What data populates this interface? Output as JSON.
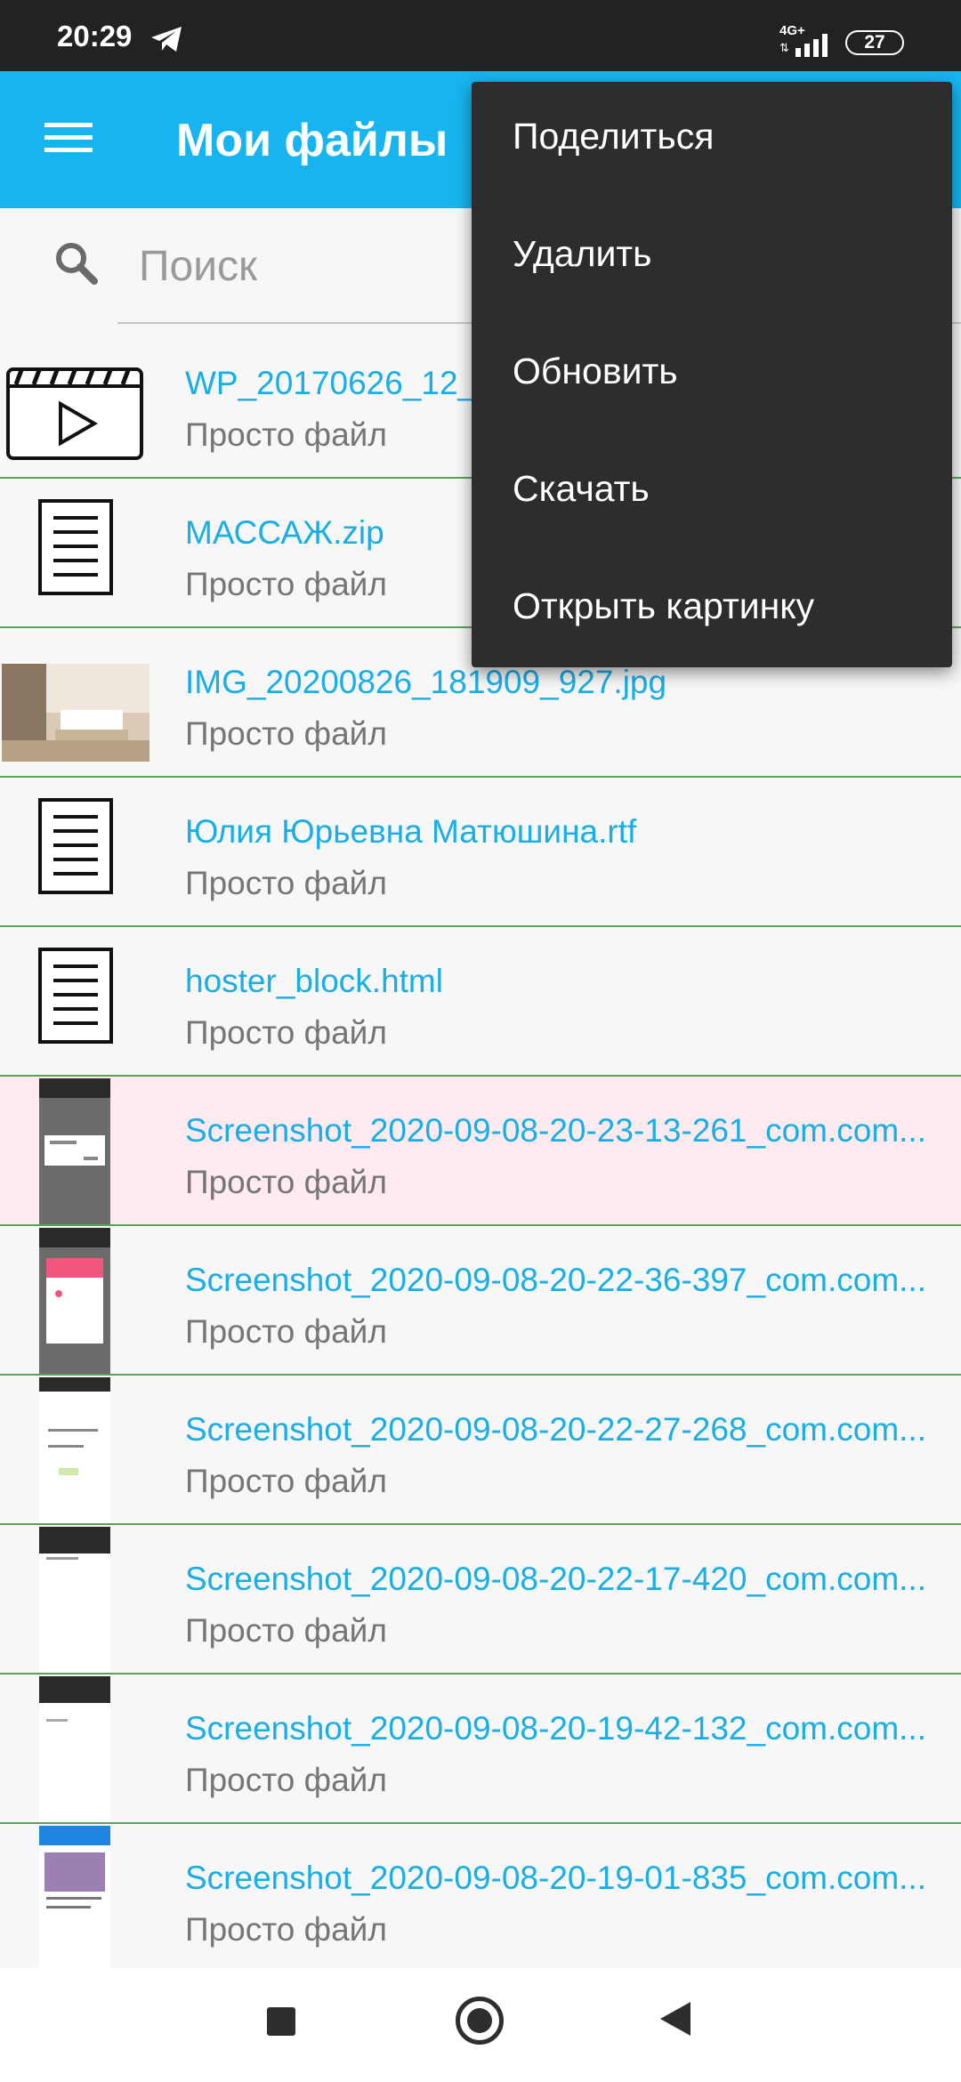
{
  "status_bar": {
    "time": "20:29",
    "network": "4G+",
    "battery": "27"
  },
  "app_bar": {
    "title": "Мои файлы",
    "menu_icon": "hamburger-icon"
  },
  "search": {
    "placeholder": "Поиск",
    "icon": "search-icon"
  },
  "files": [
    {
      "name": "WP_20170626_12_",
      "subtitle": "Просто файл",
      "icon": "video-icon"
    },
    {
      "name": "МАССАЖ.zip",
      "subtitle": "Просто файл",
      "icon": "document-icon"
    },
    {
      "name": "IMG_20200826_181909_927.jpg",
      "subtitle": "Просто файл",
      "icon": "photo-thumbnail"
    },
    {
      "name": "Юлия Юрьевна Матюшина.rtf",
      "subtitle": "Просто файл",
      "icon": "document-icon"
    },
    {
      "name": "hoster_block.html",
      "subtitle": "Просто файл",
      "icon": "document-icon"
    },
    {
      "name": "Screenshot_2020-09-08-20-23-13-261_com.com...",
      "subtitle": "Просто файл",
      "icon": "screenshot-thumbnail",
      "selected": true
    },
    {
      "name": "Screenshot_2020-09-08-20-22-36-397_com.com...",
      "subtitle": "Просто файл",
      "icon": "screenshot-thumbnail"
    },
    {
      "name": "Screenshot_2020-09-08-20-22-27-268_com.com...",
      "subtitle": "Просто файл",
      "icon": "screenshot-thumbnail"
    },
    {
      "name": "Screenshot_2020-09-08-20-22-17-420_com.com...",
      "subtitle": "Просто файл",
      "icon": "screenshot-thumbnail"
    },
    {
      "name": "Screenshot_2020-09-08-20-19-42-132_com.com...",
      "subtitle": "Просто файл",
      "icon": "screenshot-thumbnail"
    },
    {
      "name": "Screenshot_2020-09-08-20-19-01-835_com.com...",
      "subtitle": "Просто файл",
      "icon": "screenshot-thumbnail"
    }
  ],
  "context_menu": {
    "items": [
      "Поделиться",
      "Удалить",
      "Обновить",
      "Скачать",
      "Открыть картинку"
    ]
  },
  "colors": {
    "accent": "#18b4f0",
    "link": "#19aee6",
    "divider": "#5aa35a",
    "selected_row": "#ffeaf0",
    "menu_bg": "#2d2d2d"
  }
}
